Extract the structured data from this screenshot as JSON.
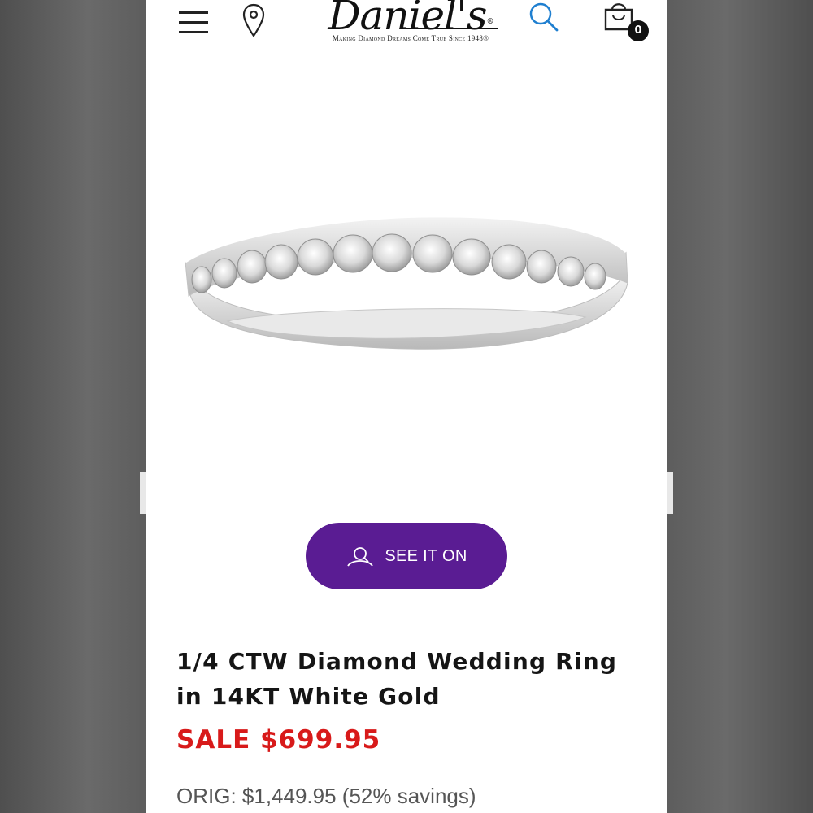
{
  "header": {
    "menu_icon": "hamburger-menu-icon",
    "location_icon": "map-pin-icon",
    "logo_text": "Daniel's",
    "logo_reg": "®",
    "logo_tagline": "Making Diamond Dreams Come True Since 1948®",
    "search_icon": "search-icon",
    "cart_icon": "shopping-bag-icon",
    "cart_count": "0"
  },
  "product": {
    "image_icon": "diamond-ring-image",
    "see_it_on_label": "SEE IT ON",
    "title": "1/4 CTW Diamond Wedding Ring in 14KT White Gold",
    "sale_price": "SALE $699.95",
    "orig_price": "ORIG: $1,449.95 (52% savings)"
  },
  "colors": {
    "accent_purple": "#5a1c93",
    "sale_red": "#d81a1a",
    "search_blue": "#1f7fd0"
  }
}
